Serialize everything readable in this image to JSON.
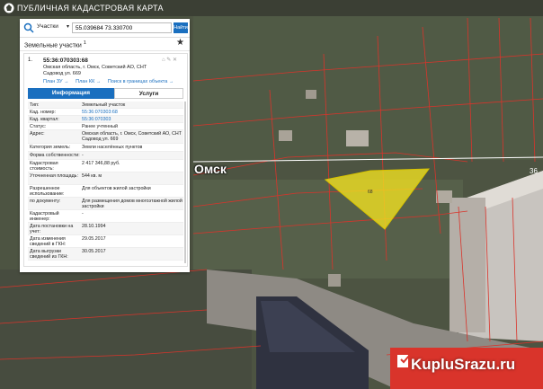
{
  "topbar": {
    "title": "ПУБЛИЧНАЯ КАДАСТРОВАЯ КАРТА"
  },
  "search": {
    "type_label": "Участки",
    "value": "55.039684 73.330700",
    "go_label": "Найти"
  },
  "layer": {
    "label": "Земельные участки",
    "count": "1"
  },
  "card": {
    "number": "1.",
    "cad_number": "55:36:070303:68",
    "address": "Омская область, г. Омск, Советский АО, СНТ Садовод ул. 669",
    "links": [
      "План ЗУ →",
      "План КК →",
      "Поиск в границах объекта →"
    ],
    "tabs": {
      "info": "Информация",
      "services": "Услуги"
    }
  },
  "rows": [
    {
      "k": "Тип:",
      "v": "Земельный участок"
    },
    {
      "k": "Кад. номер:",
      "v": "55:36:070303:68",
      "link": true
    },
    {
      "k": "Кад. квартал:",
      "v": "55:36:070303",
      "link": true
    },
    {
      "k": "Статус:",
      "v": "Ранее учтенный"
    },
    {
      "k": "Адрес:",
      "v": "Омская область, г. Омск, Советский АО, СНТ Садовод ул. 669"
    },
    {
      "k": "Категория земель:",
      "v": "Земли населённых пунктов"
    },
    {
      "k": "Форма собственности:",
      "v": "-"
    },
    {
      "k": "Кадастровая стоимость:",
      "v": "2 417 346,88 руб."
    },
    {
      "k": "Уточненная площадь:",
      "v": "544 кв. м"
    },
    {
      "k": "Разрешенное использование:",
      "v": "Для объектов жилой застройки"
    },
    {
      "k": "по документу:",
      "v": "Для размещения домов многоэтажной жилой застройки"
    },
    {
      "k": "Кадастровый инженер:",
      "v": "-"
    },
    {
      "k": "Дата постановки на учет:",
      "v": "28.10.1994"
    },
    {
      "k": "Дата изменения сведений в ГКН:",
      "v": "29.05.2017"
    },
    {
      "k": "Дата выгрузки сведений из ГКН:",
      "v": "30.05.2017"
    }
  ],
  "map": {
    "city": "Омск",
    "plot_label": "68",
    "street_num": "36"
  },
  "watermark": {
    "text": "KupluSrazu.ru"
  },
  "colors": {
    "accent": "#1a6fbf",
    "plot_fill": "#f0e020",
    "boundary": "#d9342b"
  }
}
